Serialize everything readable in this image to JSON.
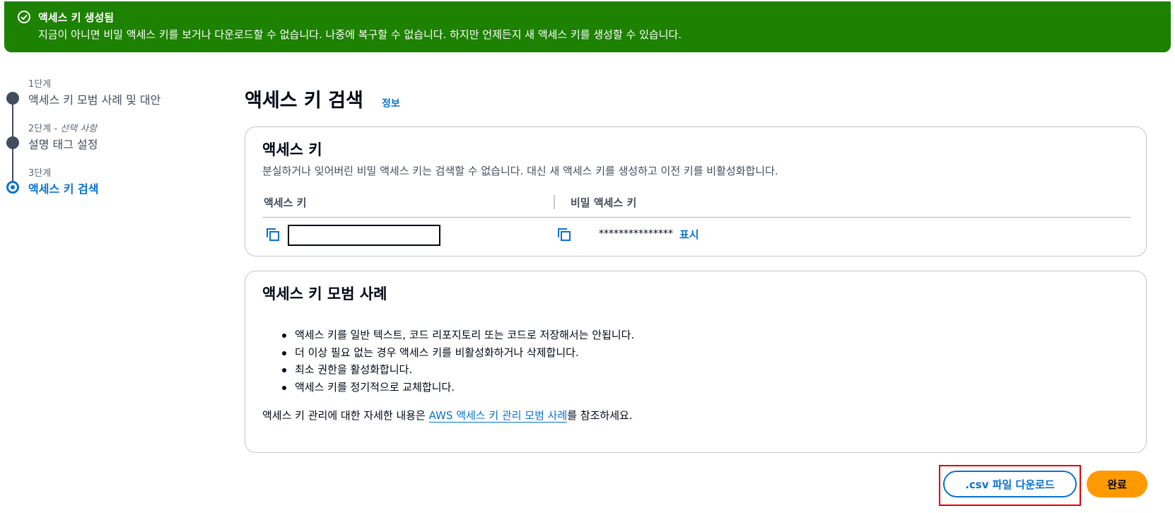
{
  "flash": {
    "title": "액세스 키 생성됨",
    "message": "지금이 아니면 비밀 액세스 키를 보거나 다운로드할 수 없습니다. 나중에 복구할 수 없습니다. 하지만 언제든지 새 액세스 키를 생성할 수 있습니다.",
    "color": "#1d8102",
    "icon": "check-circle-icon"
  },
  "steps": [
    {
      "number": "1단계",
      "optional": "",
      "label": "액세스 키 모범 사례 및 대안",
      "state": "completed"
    },
    {
      "number": "2단계",
      "optional": " - 선택 사항",
      "label": "설명 태그 설정",
      "state": "completed"
    },
    {
      "number": "3단계",
      "optional": "",
      "label": "액세스 키 검색",
      "state": "active"
    }
  ],
  "page": {
    "title": "액세스 키 검색",
    "info_link": "정보"
  },
  "access_key_card": {
    "title": "액세스 키",
    "description": "분실하거나 잊어버린 비밀 액세스 키는 검색할 수 없습니다. 대신 새 액세스 키를 생성하고 이전 키를 비활성화합니다.",
    "col_access_key": "액세스 키",
    "col_secret_key": "비밀 액세스 키",
    "access_key_value": "",
    "secret_mask": "***************",
    "show_label": "표시"
  },
  "best_practices_card": {
    "title": "액세스 키 모범 사례",
    "bullets": [
      "액세스 키를 일반 텍스트, 코드 리포지토리 또는 코드로 저장해서는 안됩니다.",
      "더 이상 필요 없는 경우 액세스 키를 비활성화하거나 삭제합니다.",
      "최소 권한을 활성화합니다.",
      "액세스 키를 정기적으로 교체합니다."
    ],
    "more_prefix": "액세스 키 관리에 대한 자세한 내용은 ",
    "more_link": "AWS 액세스 키 관리 모범 사례",
    "more_suffix": "를 참조하세요."
  },
  "actions": {
    "download_csv": ".csv 파일 다운로드",
    "done": "완료",
    "accent": "#ff9900",
    "link_color": "#0972d3"
  }
}
